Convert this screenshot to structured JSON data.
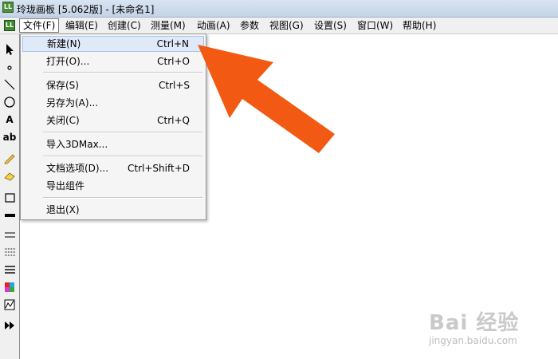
{
  "window": {
    "app_icon": "app-logo-icon",
    "app_icon_text": "LL",
    "title": "玲珑画板 [5.062版] - [未命名1]"
  },
  "menubar": {
    "icon": "document-icon",
    "icon_text": "LL",
    "items": [
      {
        "label": "文件(F)"
      },
      {
        "label": "编辑(E)"
      },
      {
        "label": "创建(C)"
      },
      {
        "label": "测量(M)"
      },
      {
        "label": "动画(A)"
      },
      {
        "label": "参数"
      },
      {
        "label": "视图(G)"
      },
      {
        "label": "设置(S)"
      },
      {
        "label": "窗口(W)"
      },
      {
        "label": "帮助(H)"
      }
    ]
  },
  "file_menu": {
    "items": [
      {
        "label": "新建(N)",
        "shortcut": "Ctrl+N",
        "highlighted": true
      },
      {
        "label": "打开(O)...",
        "shortcut": "Ctrl+O"
      },
      {
        "label": "保存(S)",
        "shortcut": "Ctrl+S"
      },
      {
        "label": "另存为(A)...",
        "shortcut": ""
      },
      {
        "label": "关闭(C)",
        "shortcut": "Ctrl+Q"
      },
      {
        "label": "导入3DMax...",
        "shortcut": ""
      },
      {
        "label": "文档选项(D)...",
        "shortcut": "Ctrl+Shift+D"
      },
      {
        "label": "导出组件",
        "shortcut": ""
      },
      {
        "label": "退出(X)",
        "shortcut": ""
      }
    ]
  },
  "toolbar": {
    "tools": [
      {
        "icon": "select-arrow-icon"
      },
      {
        "icon": "point-icon"
      },
      {
        "icon": "line-icon"
      },
      {
        "icon": "circle-icon"
      },
      {
        "icon": "text-a-icon",
        "text": "A"
      },
      {
        "icon": "text-ab-icon",
        "text": "ab"
      },
      {
        "icon": "pencil-icon"
      },
      {
        "icon": "eraser-icon"
      },
      {
        "icon": "rectangle-icon"
      },
      {
        "icon": "thick-line-icon"
      },
      {
        "icon": "double-line-icon"
      },
      {
        "icon": "dotted-lines-icon"
      },
      {
        "icon": "triple-line-icon"
      },
      {
        "icon": "color-palette-icon"
      },
      {
        "icon": "graph-icon"
      },
      {
        "icon": "play-forward-icon"
      }
    ]
  },
  "annotation": {
    "arrow_color": "#f25a14"
  },
  "watermark": {
    "logo": "Bai 经验",
    "url": "jingyan.baidu.com"
  },
  "colors": {
    "menu_highlight": "#dfe9f8",
    "titlebar": "#c4d3e6"
  }
}
